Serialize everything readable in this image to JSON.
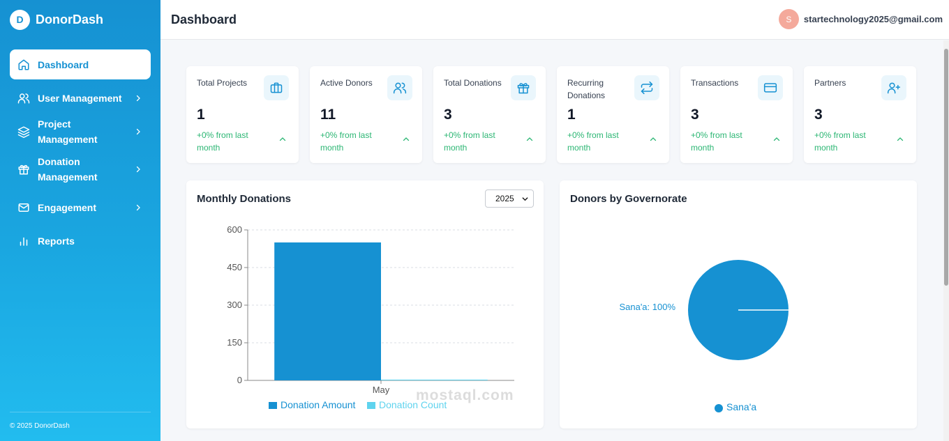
{
  "brand": {
    "logo_letter": "D",
    "name": "DonorDash"
  },
  "sidebar": {
    "items": [
      {
        "label": "Dashboard",
        "icon": "home-icon",
        "active": true,
        "has_submenu": false
      },
      {
        "label": "User Management",
        "icon": "users-icon",
        "active": false,
        "has_submenu": true
      },
      {
        "label": "Project Management",
        "icon": "layers-icon",
        "active": false,
        "has_submenu": true
      },
      {
        "label": "Donation Management",
        "icon": "gift-icon",
        "active": false,
        "has_submenu": true
      },
      {
        "label": "Engagement",
        "icon": "mail-icon",
        "active": false,
        "has_submenu": true
      },
      {
        "label": "Reports",
        "icon": "bar-chart-icon",
        "active": false,
        "has_submenu": false
      }
    ],
    "footer": "© 2025 DonorDash"
  },
  "header": {
    "title": "Dashboard",
    "user": {
      "avatar_letter": "S",
      "email": "startechnology2025@gmail.com"
    }
  },
  "stats": [
    {
      "title": "Total Projects",
      "value": "1",
      "change": "+0% from last month",
      "icon": "briefcase-icon"
    },
    {
      "title": "Active Donors",
      "value": "11",
      "change": "+0% from last month",
      "icon": "users-icon"
    },
    {
      "title": "Total Donations",
      "value": "3",
      "change": "+0% from last month",
      "icon": "gift-icon"
    },
    {
      "title": "Recurring Donations",
      "value": "1",
      "change": "+0% from last month",
      "icon": "repeat-icon"
    },
    {
      "title": "Transactions",
      "value": "3",
      "change": "+0% from last month",
      "icon": "credit-card-icon"
    },
    {
      "title": "Partners",
      "value": "3",
      "change": "+0% from last month",
      "icon": "user-plus-icon"
    }
  ],
  "monthly": {
    "title": "Monthly Donations",
    "year_selected": "2025"
  },
  "governorate": {
    "title": "Donors by Governorate"
  },
  "colors": {
    "primary": "#1691d2",
    "secondary": "#5fd3ee",
    "positive": "#2bb673"
  },
  "watermark": "mostaql.com",
  "chart_data": [
    {
      "type": "bar",
      "title": "Monthly Donations",
      "categories": [
        "May"
      ],
      "series": [
        {
          "name": "Donation Amount",
          "values": [
            550
          ],
          "color": "#1691d2"
        },
        {
          "name": "Donation Count",
          "values": [
            3
          ],
          "color": "#5fd3ee"
        }
      ],
      "ylim": [
        0,
        600
      ],
      "yticks": [
        0,
        150,
        300,
        450,
        600
      ],
      "grid": true,
      "legend": "bottom"
    },
    {
      "type": "pie",
      "title": "Donors by Governorate",
      "slices": [
        {
          "label": "Sana'a",
          "value": 100,
          "data_label": "Sana'a: 100%",
          "color": "#1691d2"
        }
      ],
      "legend": "bottom"
    }
  ]
}
